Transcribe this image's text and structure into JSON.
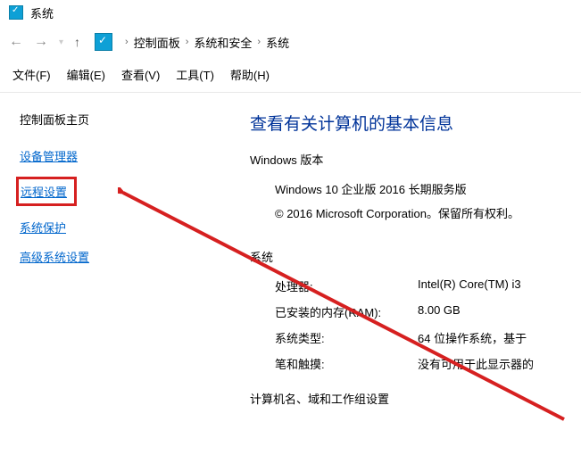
{
  "title": "系统",
  "breadcrumb": {
    "items": [
      "控制面板",
      "系统和安全",
      "系统"
    ]
  },
  "menu": {
    "file": "文件(F)",
    "edit": "编辑(E)",
    "view": "查看(V)",
    "tools": "工具(T)",
    "help": "帮助(H)"
  },
  "sidebar": {
    "home": "控制面板主页",
    "links": {
      "device_manager": "设备管理器",
      "remote_settings": "远程设置",
      "system_protection": "系统保护",
      "advanced_settings": "高级系统设置"
    }
  },
  "main": {
    "heading": "查看有关计算机的基本信息",
    "windows_edition_label": "Windows 版本",
    "edition": "Windows 10 企业版 2016 长期服务版",
    "copyright": "© 2016 Microsoft Corporation。保留所有权利。",
    "system_label": "系统",
    "props": {
      "processor": {
        "label": "处理器:",
        "value": "Intel(R) Core(TM) i3"
      },
      "ram": {
        "label": "已安装的内存(RAM):",
        "value": "8.00 GB"
      },
      "system_type": {
        "label": "系统类型:",
        "value": "64 位操作系统，基于"
      },
      "pen_touch": {
        "label": "笔和触摸:",
        "value": "没有可用于此显示器的"
      }
    },
    "footer": "计算机名、域和工作组设置"
  }
}
